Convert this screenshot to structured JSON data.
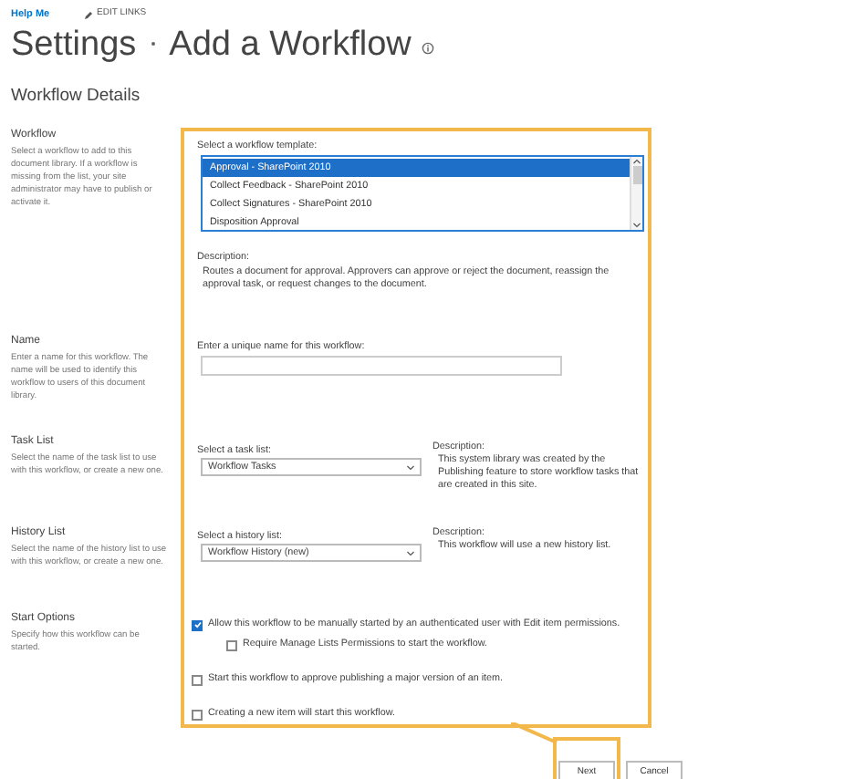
{
  "top_links": {
    "help": "Help Me",
    "edit": "EDIT LINKS"
  },
  "breadcrumb": [
    "Settings",
    "Add a Workflow"
  ],
  "section_title": "Workflow Details",
  "sections": [
    {
      "heading": "Workflow",
      "description": "Select a workflow to add to this document library. If a workflow is missing from the list, your site administrator may have to publish or activate it."
    },
    {
      "heading": "Name",
      "description": "Enter a name for this workflow. The name will be used to identify this workflow to users of this document library."
    },
    {
      "heading": "Task List",
      "description": "Select the name of the task list to use with this workflow, or create a new one."
    },
    {
      "heading": "History List",
      "description": "Select the name of the history list to use with this workflow, or create a new one."
    },
    {
      "heading": "Start Options",
      "description": "Specify how this workflow can be started."
    }
  ],
  "template": {
    "label": "Select a workflow template:",
    "options": [
      {
        "label": "Approval - SharePoint 2010",
        "selected": true
      },
      {
        "label": "Collect Feedback - SharePoint 2010",
        "selected": false
      },
      {
        "label": "Collect Signatures - SharePoint 2010",
        "selected": false
      },
      {
        "label": "Disposition Approval",
        "selected": false
      }
    ],
    "description_label": "Description:",
    "description": "Routes a document for approval. Approvers can approve or reject the document, reassign the approval task, or request changes to the document."
  },
  "name_field": {
    "label": "Enter a unique name for this workflow:"
  },
  "task_list": {
    "label": "Select a task list:",
    "value": "Workflow Tasks",
    "description_label": "Description:",
    "description": "This system library was created by the Publishing feature to store workflow tasks that are created in this site."
  },
  "history_list": {
    "label": "Select a history list:",
    "value": "Workflow History (new)",
    "description_label": "Description:",
    "description": "This workflow will use a new history list."
  },
  "start_options": [
    {
      "label": "Allow this workflow to be manually started by an authenticated user with Edit item permissions.",
      "checked": true,
      "children": [
        {
          "label": "Require Manage Lists Permissions to start the workflow.",
          "checked": false
        }
      ]
    },
    {
      "label": "Start this workflow to approve publishing a major version of an item.",
      "checked": false
    },
    {
      "label": "Creating a new item will start this workflow.",
      "checked": false
    }
  ],
  "buttons": [
    {
      "label": "Next",
      "highlighted": true
    },
    {
      "label": "Cancel",
      "highlighted": false
    }
  ]
}
